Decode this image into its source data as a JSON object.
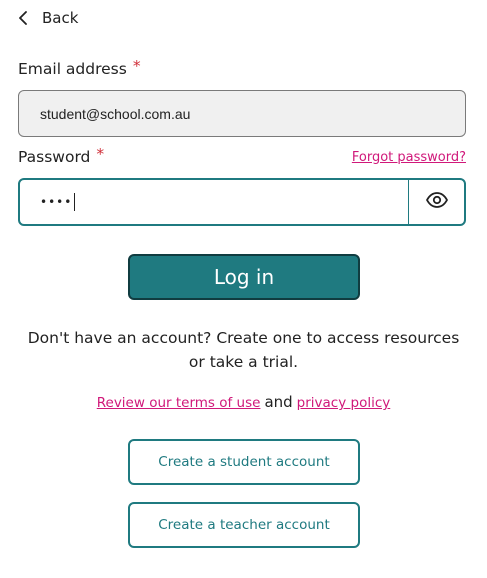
{
  "back": {
    "label": "Back",
    "icon": "chevron-left-icon"
  },
  "email": {
    "label": "Email address",
    "required_mark": "*",
    "value": "student@school.com.au"
  },
  "password": {
    "label": "Password",
    "required_mark": "*",
    "masked_value": "••••",
    "forgot_link": "Forgot password?",
    "toggle_icon": "eye-icon"
  },
  "login": {
    "label": "Log in"
  },
  "signup": {
    "prompt": "Don't have an account? Create one to access resources or take a trial."
  },
  "legal": {
    "terms_link": "Review our terms of use",
    "and_text": "and",
    "privacy_link": "privacy policy"
  },
  "accounts": {
    "student_button": "Create a student account",
    "teacher_button": "Create a teacher account"
  },
  "colors": {
    "teal": "#1f7a80",
    "magenta_link": "#d0187a",
    "required": "#d0303a"
  }
}
